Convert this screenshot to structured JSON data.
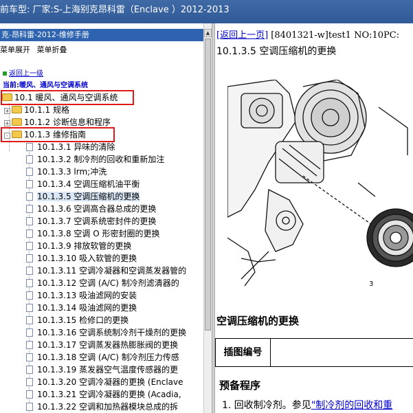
{
  "topbar": {
    "title": "前车型:  厂家:S-上海别克昂科雷（Enclave ）2012-2013"
  },
  "left_panel": {
    "header": "克-昂科雷-2012-维修手册",
    "toolbar": {
      "expand": "菜单展开",
      "collapse": "菜单折叠"
    },
    "back_link": "返回上一级",
    "current": "当前:暖风、通风与空调系统",
    "tree": {
      "root": "10.1 暖风、通风与空调系统",
      "children": [
        {
          "label": "10.1.1 规格",
          "expander": "+"
        },
        {
          "label": "10.1.2 诊断信息和程序",
          "expander": "+"
        },
        {
          "label": "10.1.3 维修指南",
          "expander": "-"
        }
      ],
      "items": [
        "10.1.3.1 异味的清除",
        "10.1.3.2 制冷剂的回收和重新加注",
        "10.1.3.3 lrm;冲洗",
        "10.1.3.4 空调压缩机油平衡",
        "10.1.3.5 空调压缩机的更换",
        "10.1.3.6 空调高合器总成的更换",
        "10.1.3.7 空调系统密封件的更换",
        "10.1.3.8 空调 O 形密封圈的更换",
        "10.1.3.9 排放软管的更换",
        "10.1.3.10 吸入软管的更换",
        "10.1.3.11 空调冷凝器和空调蒸发器管的",
        "10.1.3.12 空调 (A/C) 制冷剂滤清器的",
        "10.1.3.13 吸油滤网的安装",
        "10.1.3.14 吸油滤网的更换",
        "10.1.3.15 检修口的更换",
        "10.1.3.16 空调系统制冷剂干燥剂的更换",
        "10.1.3.17 空调蒸发器热膨胀阀的更换",
        "10.1.3.18 空调 (A/C) 制冷剂压力传感",
        "10.1.3.19 蒸发器空气温度传感器的更",
        "10.1.3.20 空调冷凝器的更换 (Enclave",
        "10.1.3.21 空调冷凝器的更换 (Acadia,",
        "10.1.3.22 空调和加热器模块总成的拆"
      ],
      "selected_index": 4
    }
  },
  "right_panel": {
    "back_link": "[返回上一页]",
    "doc_ref": "[8401321-w]test1 NO:10PC:",
    "section_title": "10.1.3.5 空调压缩机的更换",
    "figure_callout": "3",
    "caption": "空调压缩机的更换",
    "table_header": "插图编号",
    "prep_title": "预备程序",
    "step_prefix": "1. 回收制冷剂。参见",
    "step_link": "\"制冷剂的回收和重"
  },
  "colors": {
    "topbar": "#3f6aa6",
    "panel_header": "#2e63b0",
    "highlight_box": "#e01818",
    "link": "#0000cc",
    "selected": "#d9e6f5"
  }
}
